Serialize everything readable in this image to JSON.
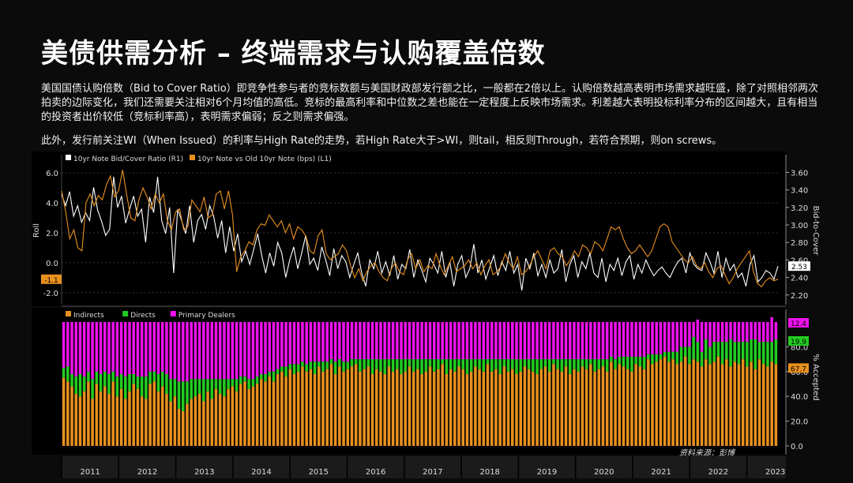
{
  "title": "美债供需分析 – 终端需求与认购覆盖倍数",
  "paragraph1": "美国国债认购倍数（Bid to Cover Ratio）即竞争性参与者的竞标数额与美国财政部发行额之比，一般都在2倍以上。认购倍数越高表明市场需求越旺盛，除了对照相邻两次拍卖的边际变化，我们还需要关注相对6个月均值的高低。竞标的最高利率和中位数之差也能在一定程度上反映市场需求。利差越大表明投标利率分布的区间越大，且有相当的投资者出价较低（竞标利率高），表明需求偏弱；反之则需求偏强。",
  "paragraph2": "此外，发行前关注WI（When Issued）的利率与High Rate的走势，若High Rate大于>WI，则tail，相反则Through，若符合预期，则on screws。",
  "source": "资料来源：彭博",
  "colors": {
    "white": "#ffffff",
    "orange": "#e8901e",
    "green": "#22cc22",
    "magenta": "#ee11ee",
    "bg": "#000000"
  },
  "chart_data": [
    {
      "type": "line",
      "legend": [
        "10yr Note Bid/Cover Ratio (R1)",
        "10yr Note vs Old 10yr Note (bps) (L1)"
      ],
      "ylabel_left": "Roll",
      "ylabel_right": "Bid-to-Cover",
      "left_ticks": [
        "6.0",
        "4.0",
        "2.0",
        "0.0",
        "-2.0"
      ],
      "right_ticks": [
        "3.60",
        "3.40",
        "3.20",
        "3.00",
        "2.80",
        "2.60",
        "2.40",
        "2.20"
      ],
      "ylim_left": [
        -2.8,
        6.8
      ],
      "ylim_right": [
        2.09,
        3.73
      ],
      "last_left_label": "-1.1",
      "last_right_label": "2.53",
      "series": [
        {
          "name": "10yr Note Bid/Cover Ratio (R1)",
          "axis": "right",
          "color": "#ffffff",
          "values": [
            3.35,
            3.22,
            3.38,
            3.1,
            3.22,
            3.03,
            3.14,
            3.05,
            3.43,
            3.17,
            3.04,
            2.88,
            2.95,
            3.55,
            3.2,
            3.33,
            3.02,
            3.18,
            3.33,
            3.1,
            3.18,
            2.8,
            3.32,
            3.14,
            3.55,
            3.05,
            2.9,
            3.2,
            2.45,
            3.18,
            3.05,
            2.9,
            3.22,
            2.8,
            3.05,
            3.12,
            2.95,
            3.22,
            3.1,
            2.85,
            3.05,
            2.68,
            2.98,
            2.7,
            2.9,
            2.58,
            2.7,
            2.55,
            2.72,
            2.9,
            2.65,
            2.45,
            2.68,
            2.53,
            2.8,
            2.68,
            2.4,
            2.6,
            2.75,
            2.5,
            2.68,
            2.88,
            2.55,
            2.62,
            2.48,
            2.75,
            2.6,
            2.42,
            2.73,
            2.5,
            2.65,
            2.58,
            2.4,
            2.55,
            2.68,
            2.45,
            2.3,
            2.6,
            2.5,
            2.7,
            2.45,
            2.58,
            2.42,
            2.65,
            2.38,
            2.55,
            2.5,
            2.72,
            2.4,
            2.6,
            2.48,
            2.35,
            2.62,
            2.55,
            2.45,
            2.7,
            2.4,
            2.58,
            2.3,
            2.55,
            2.65,
            2.4,
            2.5,
            2.78,
            2.45,
            2.6,
            2.38,
            2.52,
            2.65,
            2.42,
            2.58,
            2.48,
            2.7,
            2.45,
            2.55,
            2.25,
            2.62,
            2.5,
            2.68,
            2.42,
            2.55,
            2.4,
            2.6,
            2.45,
            2.5,
            2.72,
            2.35,
            2.55,
            2.65,
            2.4,
            2.58,
            2.5,
            2.68,
            2.45,
            2.4,
            2.62,
            2.35,
            2.55,
            2.48,
            2.62,
            2.42,
            2.58,
            2.65,
            2.38,
            2.55,
            2.45,
            2.6,
            2.5,
            2.42,
            2.48,
            2.52,
            2.45,
            2.4,
            2.5,
            2.58,
            2.62,
            2.45,
            2.68,
            2.55,
            2.5,
            2.48,
            2.68,
            2.58,
            2.45,
            2.7,
            2.4,
            2.62,
            2.48,
            2.55,
            2.4,
            2.45,
            2.3,
            2.55,
            2.65,
            2.35,
            2.4,
            2.48,
            2.45,
            2.38,
            2.53
          ]
        },
        {
          "name": "10yr Note vs Old 10yr Note (bps) (L1)",
          "axis": "left",
          "color": "#e8901e",
          "values": [
            4.8,
            3.4,
            1.6,
            2.2,
            1.0,
            0.8,
            4.0,
            4.6,
            3.8,
            4.5,
            4.2,
            5.2,
            5.8,
            4.4,
            4.8,
            6.2,
            4.5,
            3.0,
            2.8,
            4.2,
            5.0,
            4.4,
            3.6,
            4.6,
            4.0,
            4.6,
            2.8,
            2.2,
            3.4,
            3.6,
            2.2,
            2.4,
            4.2,
            3.8,
            3.4,
            4.4,
            3.0,
            3.2,
            4.6,
            4.8,
            3.6,
            4.8,
            3.2,
            -0.6,
            0.4,
            0.8,
            1.4,
            1.2,
            2.2,
            2.6,
            2.5,
            3.2,
            2.8,
            2.4,
            2.8,
            2.0,
            2.6,
            1.6,
            2.4,
            2.2,
            1.8,
            0.8,
            0.6,
            1.8,
            2.2,
            0.6,
            0.2,
            0.4,
            0.6,
            1.2,
            0.8,
            -0.2,
            -1.0,
            -0.4,
            -1.2,
            -0.6,
            -0.2,
            0.0,
            -0.6,
            -1.0,
            -1.2,
            -0.4,
            0.0,
            -0.6,
            -0.8,
            0.2,
            0.6,
            -0.4,
            0.2,
            -0.6,
            -0.2,
            -0.4,
            0.6,
            -0.2,
            -0.8,
            -0.2,
            0.4,
            -0.6,
            -0.4,
            -0.2,
            0.2,
            -0.4,
            0.0,
            -0.8,
            -0.2,
            0.2,
            -0.8,
            -0.6,
            -0.2,
            0.6,
            0.0,
            -0.4,
            0.4,
            -0.8,
            -0.6,
            -0.2,
            0.4,
            0.8,
            0.2,
            -0.4,
            0.8,
            1.0,
            0.6,
            0.4,
            -0.2,
            0.2,
            0.8,
            0.4,
            1.2,
            1.0,
            0.6,
            1.4,
            1.2,
            0.8,
            1.6,
            2.4,
            2.2,
            2.4,
            1.6,
            1.0,
            0.6,
            0.8,
            1.2,
            0.8,
            0.4,
            0.8,
            1.6,
            2.4,
            2.6,
            2.4,
            1.4,
            1.0,
            0.6,
            0.2,
            0.0,
            0.4,
            -0.2,
            -0.4,
            0.0,
            -0.6,
            -1.0,
            -0.4,
            -0.2,
            -0.8,
            -1.4,
            -1.0,
            -0.4,
            0.0,
            0.4,
            0.8,
            -0.6,
            -1.4,
            -1.6,
            -1.2,
            -1.0,
            -1.2,
            -1.1
          ]
        }
      ]
    },
    {
      "type": "bar",
      "stacked": true,
      "legend": [
        "Indirects",
        "Directs",
        "Primary Dealers"
      ],
      "ylabel_right": "% Accepted",
      "right_ticks": [
        "80.0",
        "60.0",
        "40.0",
        "20.0",
        "0.0"
      ],
      "ylim": [
        0,
        100
      ],
      "x_labels": [
        "2011",
        "2012",
        "2013",
        "2014",
        "2015",
        "2016",
        "2017",
        "2018",
        "2019",
        "2020",
        "2021",
        "2022",
        "2023"
      ],
      "last_labels": {
        "primary_dealers": "12.4",
        "directs": "19.9",
        "indirects": "67.7"
      },
      "series": [
        {
          "name": "Indirects",
          "color": "#e8901e",
          "values": [
            55,
            52,
            48,
            42,
            40,
            44,
            52,
            38,
            50,
            44,
            48,
            42,
            52,
            40,
            46,
            38,
            44,
            50,
            46,
            40,
            38,
            50,
            52,
            44,
            48,
            42,
            36,
            40,
            30,
            28,
            34,
            38,
            40,
            42,
            36,
            44,
            38,
            46,
            42,
            40,
            46,
            48,
            44,
            50,
            52,
            46,
            48,
            50,
            54,
            52,
            56,
            52,
            58,
            60,
            56,
            62,
            58,
            60,
            64,
            60,
            62,
            58,
            64,
            60,
            62,
            66,
            58,
            64,
            60,
            62,
            64,
            66,
            60,
            62,
            64,
            58,
            62,
            60,
            58,
            64,
            60,
            62,
            58,
            60,
            64,
            60,
            62,
            58,
            60,
            64,
            60,
            62,
            66,
            58,
            62,
            60,
            64,
            62,
            58,
            60,
            64,
            62,
            60,
            66,
            60,
            62,
            58,
            64,
            60,
            62,
            58,
            60,
            64,
            62,
            60,
            58,
            62,
            64,
            60,
            66,
            62,
            60,
            64,
            58,
            62,
            60,
            64,
            62,
            66,
            60,
            62,
            64,
            60,
            68,
            62,
            66,
            64,
            62,
            60,
            66,
            64,
            62,
            70,
            66,
            68,
            70,
            72,
            68,
            70,
            66,
            68,
            72,
            66,
            70,
            68,
            64,
            70,
            66,
            68,
            72,
            66,
            70,
            64,
            68,
            66,
            70,
            64,
            68,
            62,
            70,
            66,
            64,
            68,
            66
          ]
        },
        {
          "name": "Directs",
          "color": "#22cc22",
          "values": [
            8,
            12,
            10,
            14,
            18,
            12,
            8,
            16,
            10,
            14,
            12,
            16,
            8,
            16,
            12,
            18,
            14,
            8,
            10,
            16,
            18,
            10,
            8,
            14,
            12,
            16,
            18,
            14,
            22,
            24,
            18,
            16,
            14,
            12,
            18,
            10,
            16,
            8,
            12,
            14,
            8,
            6,
            10,
            6,
            4,
            8,
            6,
            6,
            4,
            6,
            4,
            8,
            4,
            4,
            8,
            4,
            8,
            6,
            4,
            6,
            6,
            10,
            4,
            8,
            6,
            4,
            10,
            6,
            8,
            6,
            6,
            4,
            10,
            8,
            6,
            12,
            8,
            10,
            12,
            6,
            10,
            8,
            12,
            10,
            6,
            10,
            8,
            12,
            10,
            6,
            10,
            8,
            4,
            12,
            8,
            10,
            6,
            8,
            12,
            10,
            6,
            8,
            10,
            4,
            10,
            8,
            12,
            6,
            10,
            8,
            12,
            10,
            6,
            8,
            10,
            12,
            8,
            6,
            10,
            4,
            8,
            10,
            6,
            12,
            8,
            10,
            6,
            8,
            4,
            10,
            8,
            6,
            10,
            4,
            8,
            6,
            8,
            10,
            12,
            6,
            8,
            10,
            4,
            8,
            6,
            4,
            4,
            8,
            6,
            10,
            12,
            8,
            14,
            18,
            16,
            12,
            16,
            14,
            16,
            12,
            18,
            14,
            22,
            16,
            18,
            14,
            20,
            18,
            24,
            14,
            18,
            20,
            16,
            20
          ]
        },
        {
          "name": "Primary Dealers",
          "color": "#ee11ee",
          "values": [
            37,
            36,
            42,
            44,
            42,
            44,
            40,
            46,
            40,
            42,
            40,
            42,
            40,
            44,
            42,
            44,
            42,
            42,
            44,
            44,
            44,
            40,
            40,
            42,
            40,
            42,
            46,
            46,
            48,
            48,
            48,
            46,
            46,
            46,
            46,
            46,
            46,
            46,
            46,
            46,
            46,
            46,
            46,
            44,
            44,
            46,
            46,
            44,
            42,
            42,
            40,
            40,
            38,
            36,
            36,
            34,
            34,
            34,
            32,
            34,
            32,
            32,
            32,
            32,
            32,
            30,
            32,
            30,
            32,
            32,
            30,
            30,
            30,
            30,
            30,
            30,
            30,
            30,
            30,
            30,
            30,
            30,
            30,
            30,
            30,
            30,
            30,
            30,
            30,
            30,
            30,
            30,
            30,
            30,
            30,
            30,
            30,
            30,
            30,
            30,
            30,
            30,
            30,
            30,
            30,
            30,
            30,
            30,
            30,
            30,
            30,
            30,
            30,
            30,
            30,
            30,
            30,
            30,
            30,
            30,
            30,
            30,
            30,
            30,
            30,
            30,
            30,
            30,
            30,
            30,
            30,
            30,
            30,
            28,
            30,
            28,
            28,
            28,
            28,
            28,
            28,
            28,
            26,
            26,
            26,
            26,
            24,
            24,
            24,
            24,
            20,
            20,
            20,
            12,
            18,
            24,
            14,
            20,
            16,
            16,
            16,
            16,
            14,
            16,
            16,
            16,
            16,
            14,
            14,
            16,
            16,
            16,
            20,
            14
          ]
        }
      ]
    }
  ]
}
